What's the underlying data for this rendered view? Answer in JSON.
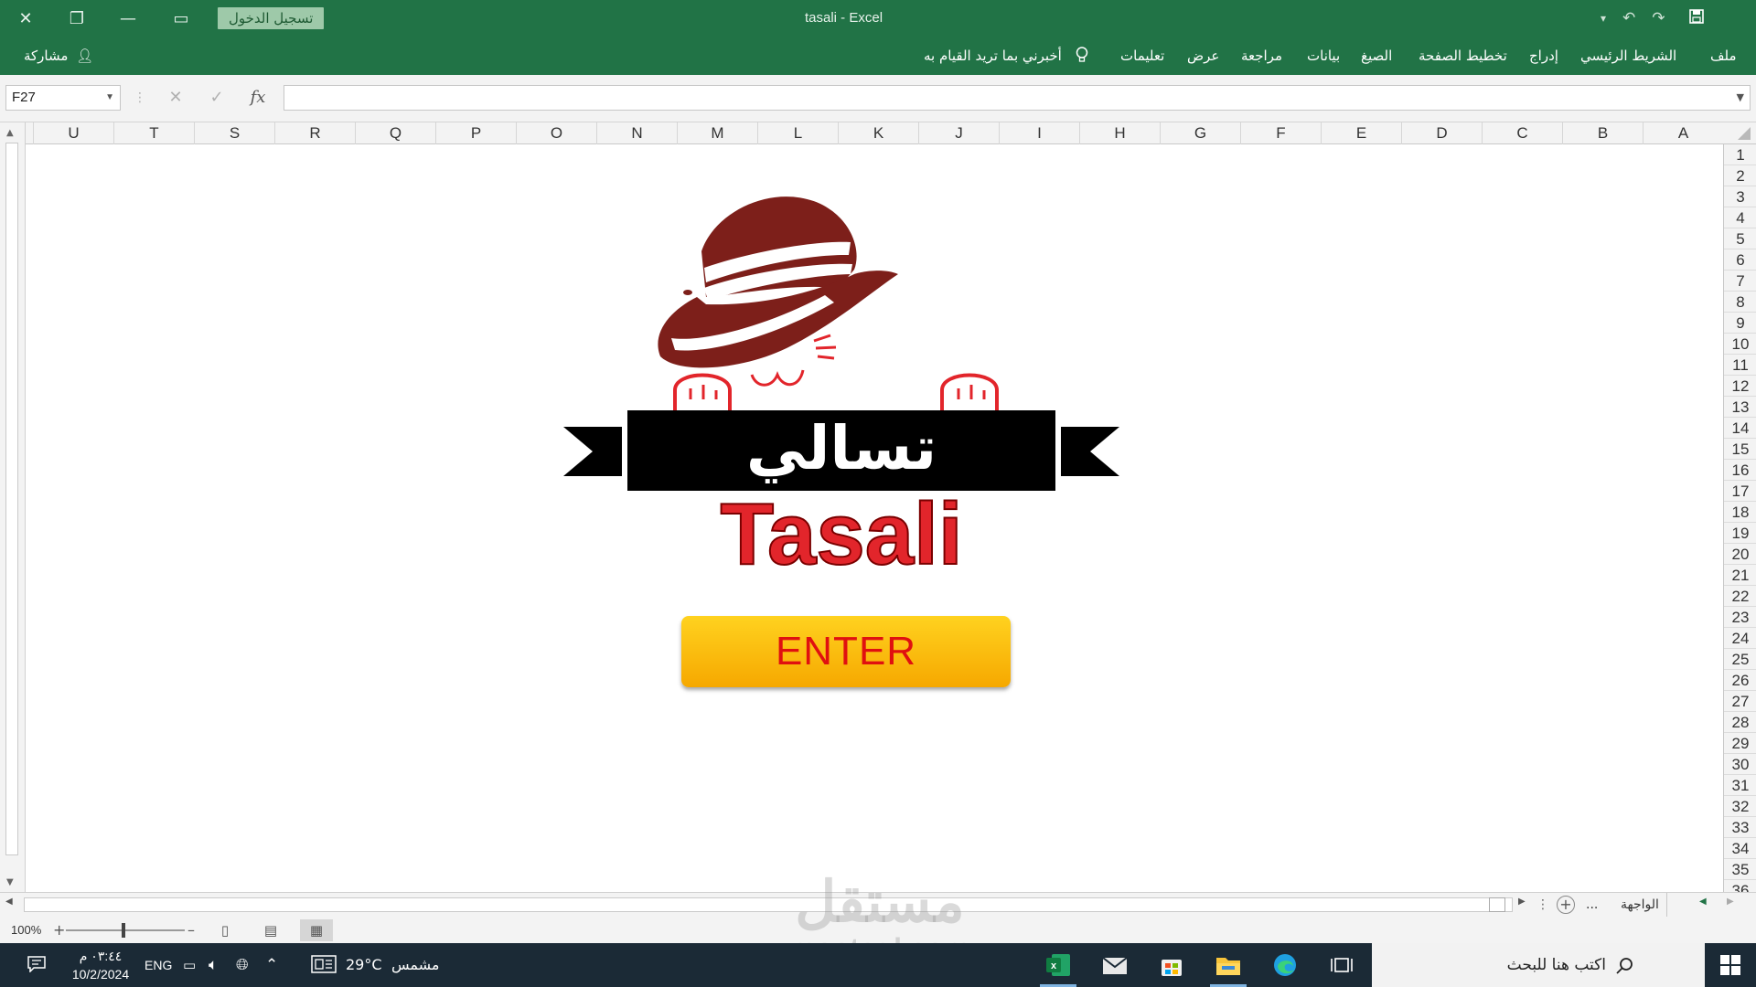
{
  "window": {
    "app_title": "tasali  -  Excel",
    "signin_label": "تسجيل الدخول"
  },
  "ribbon": {
    "tabs": [
      "ملف",
      "الشريط الرئيسي",
      "إدراج",
      "تخطيط الصفحة",
      "الصيغ",
      "بيانات",
      "مراجعة",
      "عرض",
      "تعليمات"
    ],
    "tell_me": "أخبرني بما تريد القيام به",
    "share_label": "مشاركة"
  },
  "formula_bar": {
    "name_box": "F27",
    "fx_label": "fx",
    "value": ""
  },
  "grid": {
    "columns": [
      "A",
      "B",
      "C",
      "D",
      "E",
      "F",
      "G",
      "H",
      "I",
      "J",
      "K",
      "L",
      "M",
      "N",
      "O",
      "P",
      "Q",
      "R",
      "S",
      "T",
      "U"
    ],
    "rows": [
      "1",
      "2",
      "3",
      "4",
      "5",
      "6",
      "7",
      "8",
      "9",
      "10",
      "11",
      "12",
      "13",
      "14",
      "15",
      "16",
      "17",
      "18",
      "19",
      "20",
      "21",
      "22",
      "23",
      "24",
      "25",
      "26",
      "27",
      "28",
      "29",
      "30",
      "31",
      "32",
      "33",
      "34",
      "35",
      "36"
    ]
  },
  "content": {
    "logo_arabic": "تسالي",
    "logo_english": "Tasali",
    "enter_button": "ENTER"
  },
  "sheets": {
    "active": "الواجهة",
    "more": "..."
  },
  "status": {
    "zoom": "100%"
  },
  "taskbar": {
    "search_placeholder": "اكتب هنا للبحث",
    "weather_temp": "29°C",
    "weather_text": "مشمس",
    "language": "ENG",
    "time": "٠٣:٤٤ م",
    "date": "10/2/2024"
  },
  "watermark": {
    "arabic": "مستقل",
    "latin": "mostaql.com"
  },
  "colors": {
    "excel_green": "#217346",
    "button_yellow": "#fcbf0f",
    "button_text": "#e01010",
    "logo_red": "#e2252b",
    "hat_brown": "#7d1f1a",
    "taskbar": "#1b2a36"
  }
}
